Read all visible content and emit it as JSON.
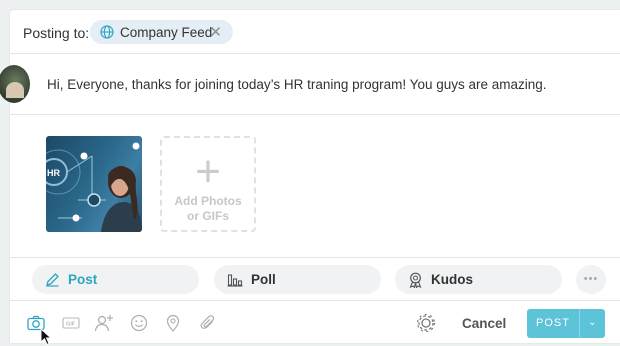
{
  "posting": {
    "label": "Posting to:",
    "destination": "Company Feed",
    "remove_symbol": "✕"
  },
  "message": {
    "text": "Hi, Everyone, thanks for joining today’s HR traning program! You guys are amazing."
  },
  "media": {
    "thumbnail_badge": "HR",
    "add_label_line1": "Add Photos",
    "add_label_line2": "or GIFs",
    "add_symbol": "+"
  },
  "tabs": [
    {
      "label": "Post",
      "icon": "pencil-icon",
      "active": true
    },
    {
      "label": "Poll",
      "icon": "bar-chart-icon",
      "active": false
    },
    {
      "label": "Kudos",
      "icon": "award-icon",
      "active": false
    }
  ],
  "more_symbol": "•••",
  "toolbar": {
    "icons": [
      "camera-icon",
      "gif-icon",
      "add-person-icon",
      "emoji-icon",
      "location-icon",
      "attachment-icon"
    ],
    "settings_icon": "gear-icon",
    "cancel_label": "Cancel",
    "post_label": "POST",
    "dropdown_symbol": "⌄"
  },
  "colors": {
    "accent": "#2fa6c1",
    "post_button": "#5cc3d8",
    "chip_bg": "#e4eef4"
  }
}
